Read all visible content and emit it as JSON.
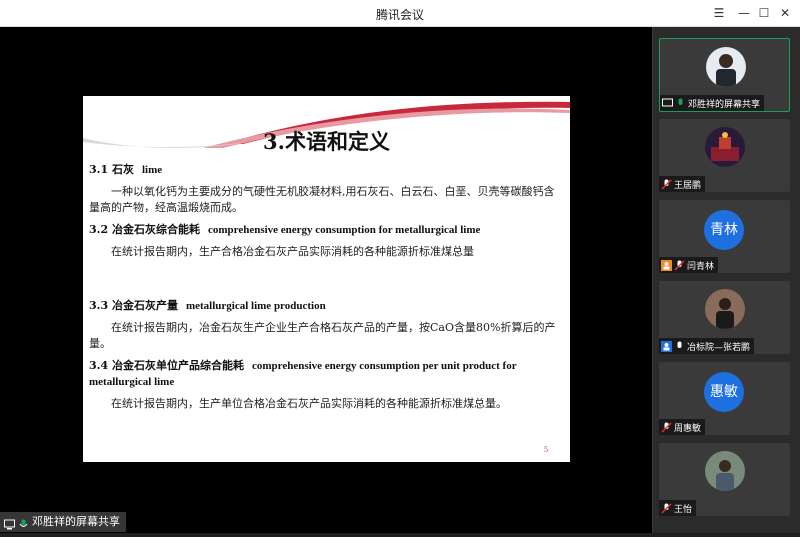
{
  "window": {
    "title": "腾讯会议",
    "menu_icon": "hamburger-icon",
    "minimize_icon": "minimize-icon",
    "maximize_icon": "maximize-icon",
    "close_icon": "close-icon"
  },
  "share": {
    "label": "邓胜祥的屏幕共享"
  },
  "slide": {
    "title": "3.术语和定义",
    "page": "5",
    "sections": [
      {
        "heading": "3.1 石灰",
        "heading_en": "lime",
        "body": "一种以氧化钙为主要成分的气硬性无机胶凝材料,用石灰石、白云石、白垩、贝壳等碳酸钙含量高的产物，经高温煅烧而成。"
      },
      {
        "heading": "3.2 冶金石灰综合能耗",
        "heading_en": "comprehensive energy consumption for metallurgical lime",
        "body": "在统计报告期内，生产合格冶金石灰产品实际消耗的各种能源折标准煤总量"
      },
      {
        "heading": "3.3 冶金石灰产量",
        "heading_en": "metallurgical lime production",
        "body": "在统计报告期内，冶金石灰生产企业生产合格石灰产品的产量，按CaO含量80%折算后的产量。"
      },
      {
        "heading": "3.4 冶金石灰单位产品综合能耗",
        "heading_en": "comprehensive energy consumption per unit product for metallurgical lime",
        "body": "在统计报告期内，生产单位合格冶金石灰产品实际消耗的各种能源折标准煤总量。"
      }
    ]
  },
  "participants": [
    {
      "name": "邓胜祥的屏幕共享",
      "type": "photo",
      "mic": "on",
      "sharing": true
    },
    {
      "name": "王居鹏",
      "type": "photo",
      "mic": "muted"
    },
    {
      "name": "闫青林",
      "type": "initials",
      "initials": "青林",
      "mic": "muted",
      "phone": true
    },
    {
      "name": "冶标院—张若鹏",
      "type": "photo",
      "mic": "on",
      "phone": true
    },
    {
      "name": "周惠敏",
      "type": "initials",
      "initials": "惠敏",
      "mic": "muted"
    },
    {
      "name": "王怡",
      "type": "photo",
      "mic": "muted"
    }
  ],
  "colors": {
    "accent_green": "#18a058",
    "avatar_blue": "#1e6fe0",
    "swoosh_red": "#c8283c"
  }
}
